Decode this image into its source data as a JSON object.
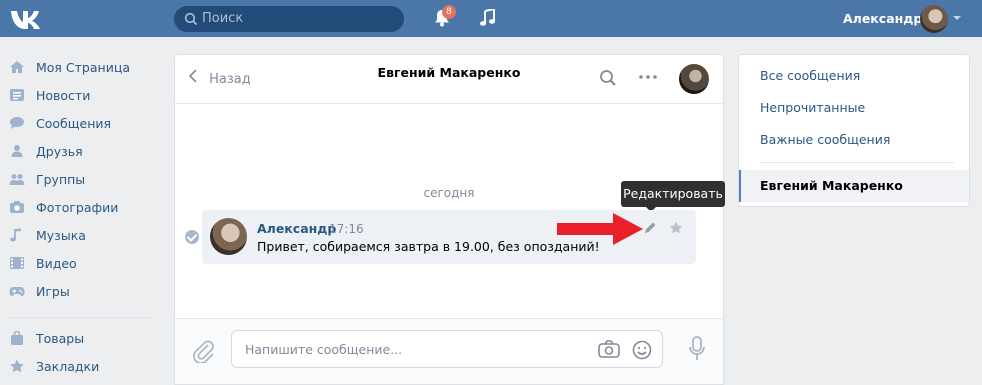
{
  "header": {
    "search_placeholder": "Поиск",
    "notifications_count": "8",
    "username": "Александр"
  },
  "sidebar": {
    "items": [
      {
        "label": "Моя Страница",
        "icon": "home-icon"
      },
      {
        "label": "Новости",
        "icon": "news-icon"
      },
      {
        "label": "Сообщения",
        "icon": "messages-icon"
      },
      {
        "label": "Друзья",
        "icon": "friends-icon"
      },
      {
        "label": "Группы",
        "icon": "groups-icon"
      },
      {
        "label": "Фотографии",
        "icon": "camera-icon"
      },
      {
        "label": "Музыка",
        "icon": "music-icon"
      },
      {
        "label": "Видео",
        "icon": "video-icon"
      },
      {
        "label": "Игры",
        "icon": "gamepad-icon"
      },
      {
        "label": "Товары",
        "icon": "bag-icon"
      },
      {
        "label": "Закладки",
        "icon": "star-icon"
      }
    ]
  },
  "chat": {
    "back_label": "Назад",
    "title": "Евгений Макаренко",
    "date_separator": "сегодня",
    "message": {
      "author": "Александр",
      "time": "17:16",
      "text": "Привет, собираемся завтра в 19.00, без опозданий!"
    },
    "tooltip": "Редактировать",
    "composer_placeholder": "Напишите сообщение..."
  },
  "right_panel": {
    "items": [
      "Все сообщения",
      "Непрочитанные",
      "Важные сообщения"
    ],
    "active_dialog": "Евгений Макаренко"
  },
  "colors": {
    "header_bg": "#4a76a8",
    "link": "#2a5885",
    "arrow": "#e8202a"
  }
}
